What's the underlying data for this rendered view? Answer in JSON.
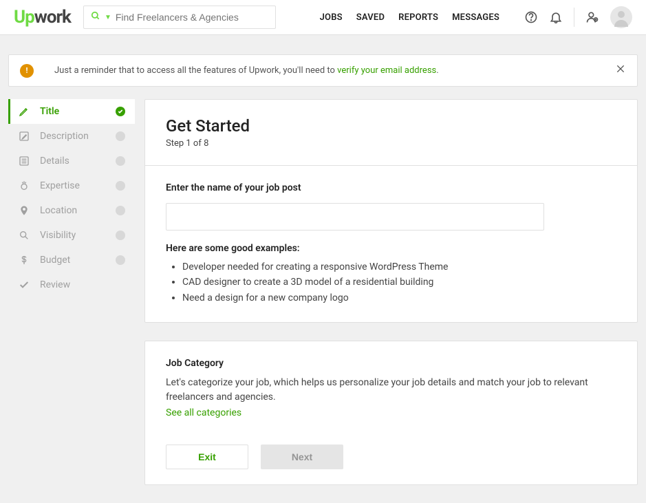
{
  "logo": {
    "part1": "Up",
    "part2": "work"
  },
  "search": {
    "placeholder": "Find Freelancers & Agencies"
  },
  "nav": {
    "jobs": "JOBS",
    "saved": "SAVED",
    "reports": "REPORTS",
    "messages": "MESSAGES"
  },
  "alert": {
    "text_before": "Just a reminder that to access all the features of Upwork, you'll need to ",
    "link": "verify your email address",
    "text_after": "."
  },
  "steps": [
    {
      "label": "Title",
      "active": true
    },
    {
      "label": "Description",
      "active": false
    },
    {
      "label": "Details",
      "active": false
    },
    {
      "label": "Expertise",
      "active": false
    },
    {
      "label": "Location",
      "active": false
    },
    {
      "label": "Visibility",
      "active": false
    },
    {
      "label": "Budget",
      "active": false
    },
    {
      "label": "Review",
      "active": false
    }
  ],
  "header": {
    "title": "Get Started",
    "step_text": "Step 1 of 8"
  },
  "form": {
    "name_label": "Enter the name of your job post",
    "examples_label": "Here are some good examples:",
    "examples": [
      "Developer needed for creating a responsive WordPress Theme",
      "CAD designer to create a 3D model of a residential building",
      "Need a design for a new company logo"
    ]
  },
  "category": {
    "title": "Job Category",
    "desc": "Let's categorize your job, which helps us personalize your job details and match your job to relevant freelancers and agencies.",
    "link": "See all categories"
  },
  "buttons": {
    "exit": "Exit",
    "next": "Next"
  }
}
